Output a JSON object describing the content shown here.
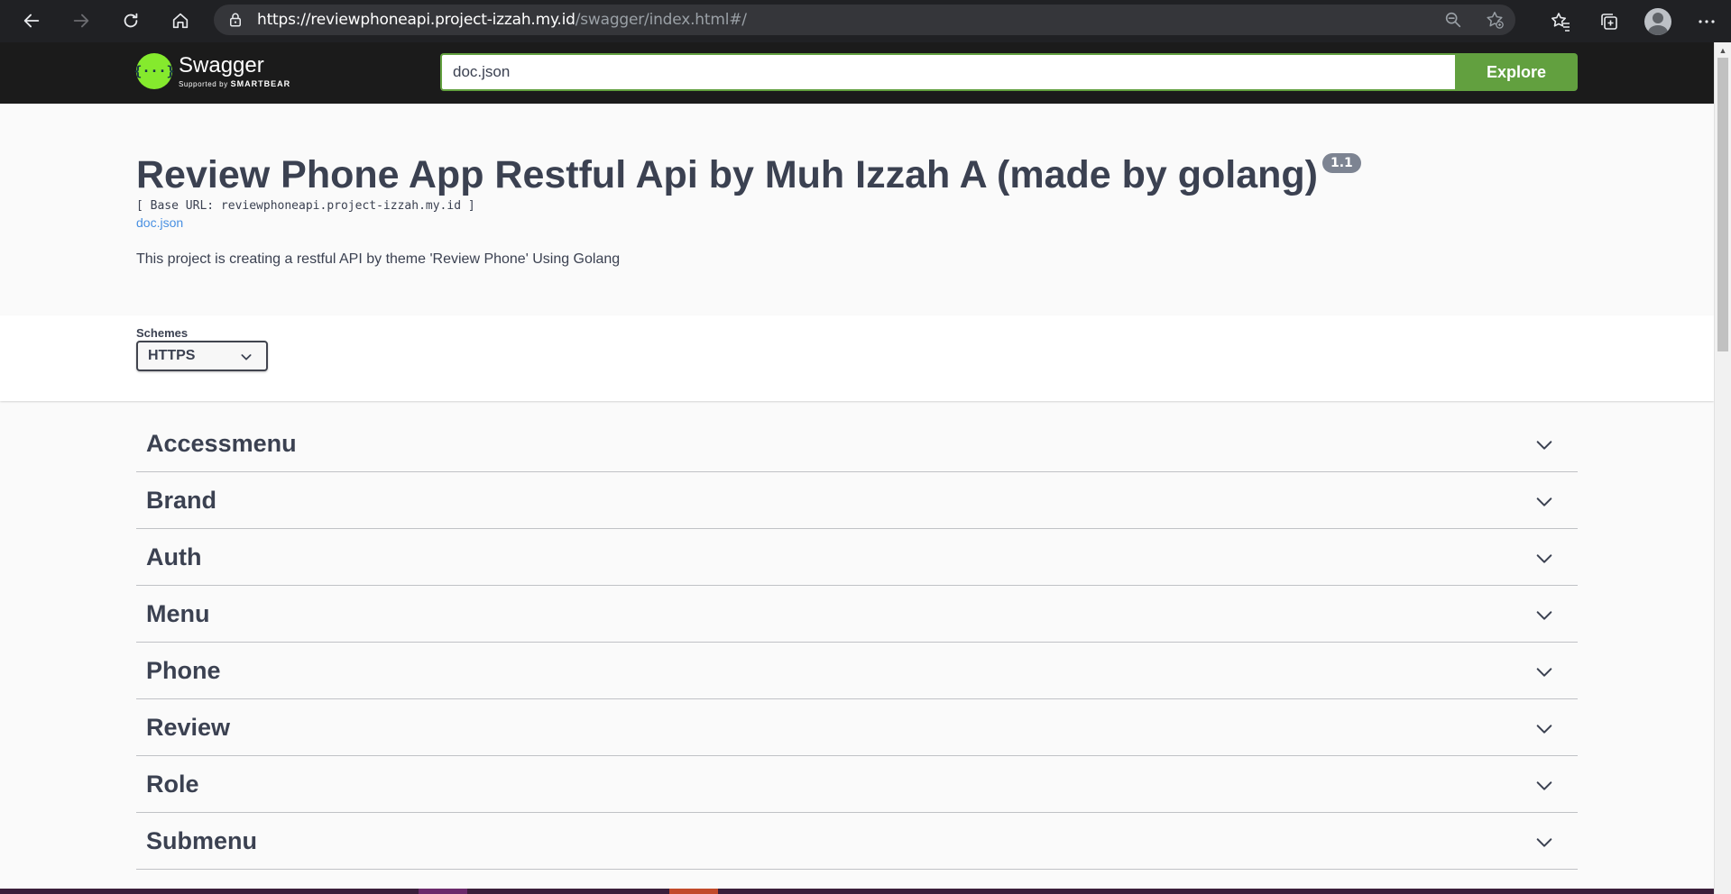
{
  "browser": {
    "url_host": "https://reviewphoneapi.project-izzah.my.id",
    "url_path": "/swagger/index.html#/"
  },
  "topbar": {
    "logo_text": "Swagger",
    "logo_sub_prefix": "Supported by",
    "logo_sub_brand": "SMARTBEAR",
    "explore_value": "doc.json",
    "explore_label": "Explore"
  },
  "info": {
    "title": "Review Phone App Restful Api by Muh Izzah A (made by golang)",
    "version": "1.1",
    "base_url": "[ Base URL: reviewphoneapi.project-izzah.my.id ]",
    "doc_link": "doc.json",
    "description": "This project is creating a restful API by theme 'Review Phone' Using Golang"
  },
  "schemes": {
    "label": "Schemes",
    "selected": "HTTPS"
  },
  "tags": [
    "Accessmenu",
    "Brand",
    "Auth",
    "Menu",
    "Phone",
    "Review",
    "Role",
    "Submenu"
  ],
  "colors": {
    "accent_green": "#62a03f",
    "logo_green": "#85ea2d",
    "text": "#3b4151",
    "link": "#4990e2"
  }
}
